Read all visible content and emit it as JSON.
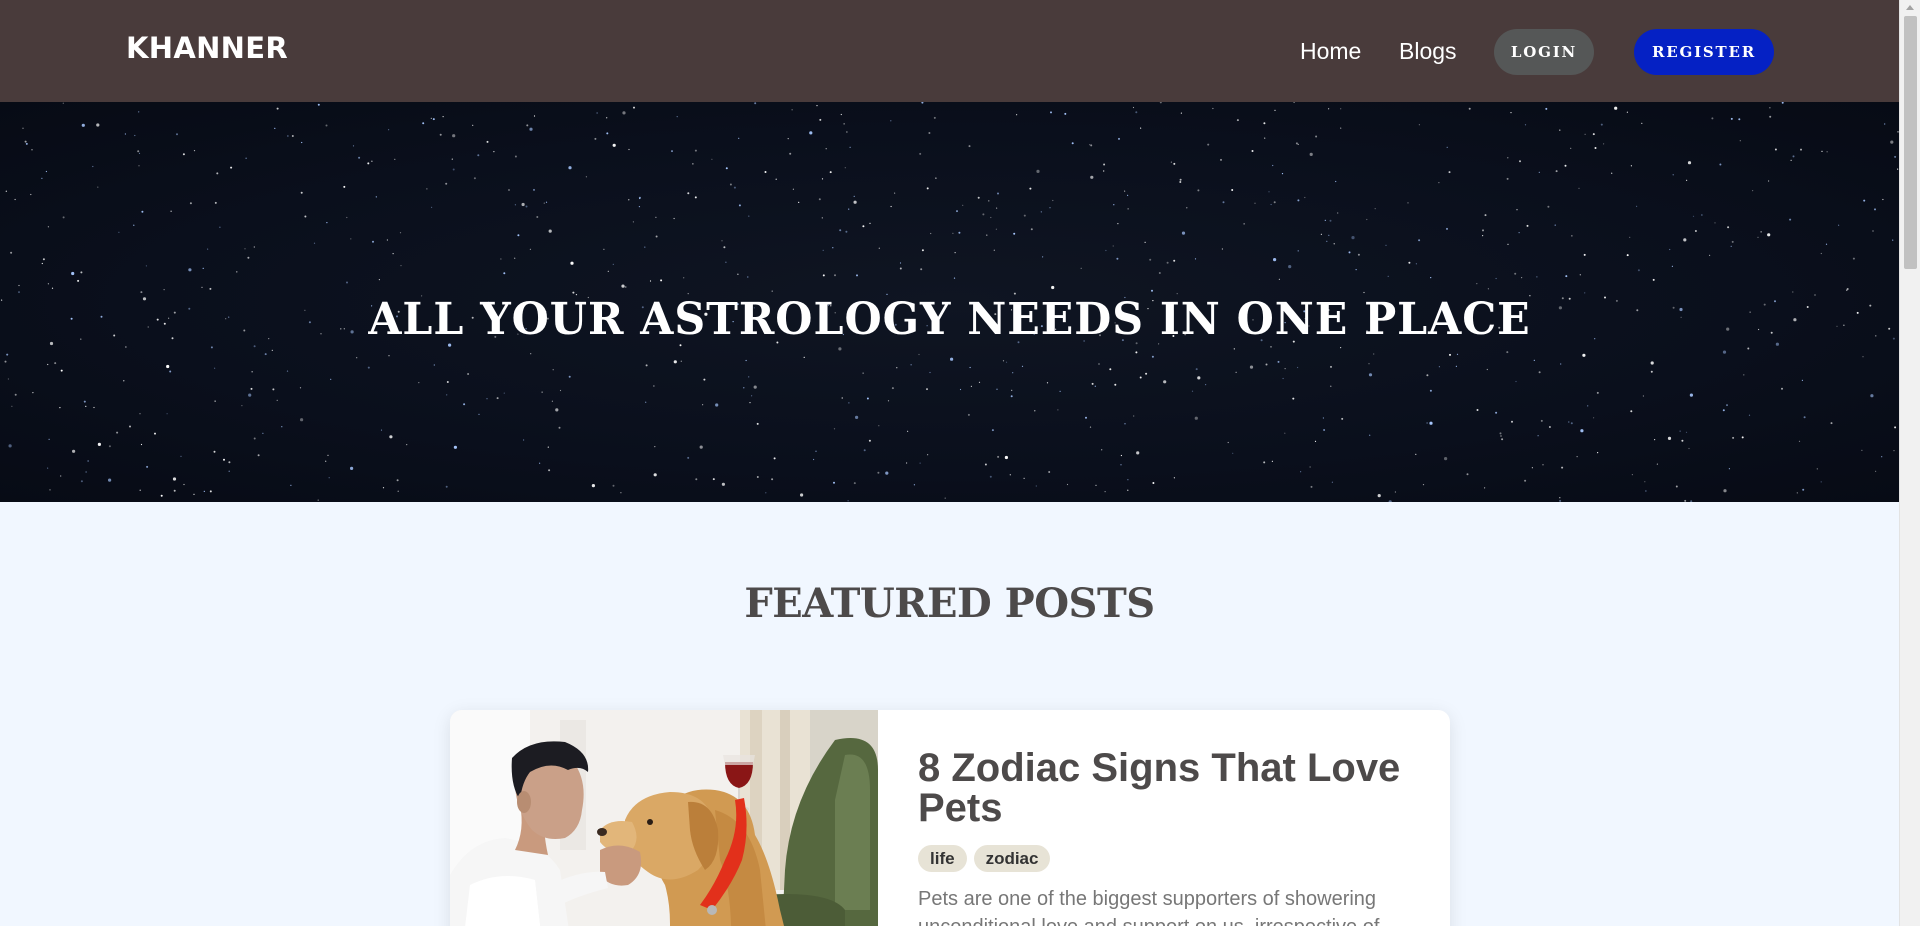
{
  "navbar": {
    "brand": "KHANNER",
    "links": [
      {
        "label": "Home"
      },
      {
        "label": "Blogs"
      }
    ],
    "login_label": "LOGIN",
    "register_label": "REGISTER",
    "colors": {
      "background": "#493b3b",
      "login": "#555757",
      "register": "#0521c4"
    }
  },
  "hero": {
    "title": "ALL YOUR ASTROLOGY NEEDS IN ONE PLACE"
  },
  "featured": {
    "heading": "FEATURED POSTS",
    "posts": [
      {
        "title": "8 Zodiac Signs That Love Pets",
        "tags": [
          "life",
          "zodiac"
        ],
        "excerpt": "Pets are one of the biggest supporters of showering unconditional love and support on us, irrespective of"
      }
    ]
  },
  "colors": {
    "page_background": "#f1f7ff",
    "heading_text": "#4d4a4a",
    "tag_background": "#e7e3d6"
  }
}
